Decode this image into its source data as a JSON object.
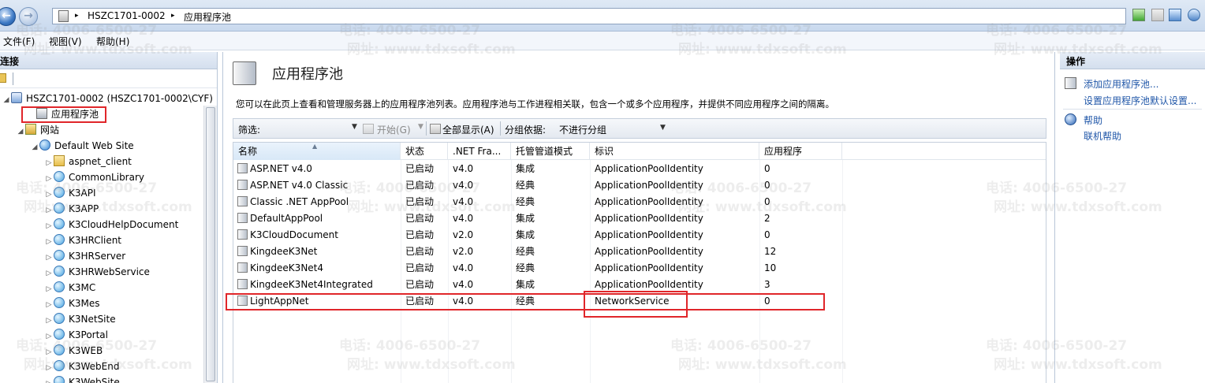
{
  "address_bar": {
    "crumbs": [
      "HSZC1701-0002",
      "应用程序池"
    ],
    "separator": "▸"
  },
  "menu": {
    "items": [
      "文件(F)",
      "视图(V)",
      "帮助(H)"
    ]
  },
  "connections": {
    "title": "连接",
    "tree": [
      {
        "label": "HSZC1701-0002 (HSZC1701-0002\\CYF)",
        "level": 0,
        "expander": "◢",
        "icon": "server-icon"
      },
      {
        "label": "应用程序池",
        "level": 1,
        "expander": "",
        "icon": "app-pools-icon",
        "selected": true
      },
      {
        "label": "网站",
        "level": 1,
        "expander": "◢",
        "icon": "sites-icon"
      },
      {
        "label": "Default Web Site",
        "level": 2,
        "expander": "◢",
        "icon": "globe-icon"
      },
      {
        "label": "aspnet_client",
        "level": 3,
        "expander": "▷",
        "icon": "folder-icon"
      },
      {
        "label": "CommonLibrary",
        "level": 3,
        "expander": "▷",
        "icon": "web-app-icon"
      },
      {
        "label": "K3API",
        "level": 3,
        "expander": "▷",
        "icon": "web-app-icon"
      },
      {
        "label": "K3APP",
        "level": 3,
        "expander": "▷",
        "icon": "web-app-icon"
      },
      {
        "label": "K3CloudHelpDocument",
        "level": 3,
        "expander": "▷",
        "icon": "web-app-icon"
      },
      {
        "label": "K3HRClient",
        "level": 3,
        "expander": "▷",
        "icon": "web-app-icon"
      },
      {
        "label": "K3HRServer",
        "level": 3,
        "expander": "▷",
        "icon": "web-app-icon"
      },
      {
        "label": "K3HRWebService",
        "level": 3,
        "expander": "▷",
        "icon": "web-app-icon"
      },
      {
        "label": "K3MC",
        "level": 3,
        "expander": "▷",
        "icon": "web-app-icon"
      },
      {
        "label": "K3Mes",
        "level": 3,
        "expander": "▷",
        "icon": "web-app-icon"
      },
      {
        "label": "K3NetSite",
        "level": 3,
        "expander": "▷",
        "icon": "web-app-icon"
      },
      {
        "label": "K3Portal",
        "level": 3,
        "expander": "▷",
        "icon": "web-app-icon"
      },
      {
        "label": "K3WEB",
        "level": 3,
        "expander": "▷",
        "icon": "web-app-icon"
      },
      {
        "label": "K3WebEnd",
        "level": 3,
        "expander": "▷",
        "icon": "web-app-icon"
      },
      {
        "label": "K3WebSite",
        "level": 3,
        "expander": "▷",
        "icon": "web-app-icon"
      }
    ]
  },
  "main": {
    "title": "应用程序池",
    "description": "您可以在此页上查看和管理服务器上的应用程序池列表。应用程序池与工作进程相关联，包含一个或多个应用程序，并提供不同应用程序之间的隔离。",
    "filter": {
      "label": "筛选:",
      "start_label": "开始(G)",
      "show_all_label": "全部显示(A)",
      "group_label": "分组依据:",
      "group_value": "不进行分组"
    },
    "columns": [
      "名称",
      "状态",
      ".NET Fra...",
      "托管管道模式",
      "标识",
      "应用程序"
    ],
    "rows": [
      [
        "ASP.NET v4.0",
        "已启动",
        "v4.0",
        "集成",
        "ApplicationPoolIdentity",
        "0"
      ],
      [
        "ASP.NET v4.0 Classic",
        "已启动",
        "v4.0",
        "经典",
        "ApplicationPoolIdentity",
        "0"
      ],
      [
        "Classic .NET AppPool",
        "已启动",
        "v4.0",
        "经典",
        "ApplicationPoolIdentity",
        "0"
      ],
      [
        "DefaultAppPool",
        "已启动",
        "v4.0",
        "集成",
        "ApplicationPoolIdentity",
        "2"
      ],
      [
        "K3CloudDocument",
        "已启动",
        "v2.0",
        "集成",
        "ApplicationPoolIdentity",
        "0"
      ],
      [
        "KingdeeK3Net",
        "已启动",
        "v2.0",
        "经典",
        "ApplicationPoolIdentity",
        "12"
      ],
      [
        "KingdeeK3Net4",
        "已启动",
        "v4.0",
        "经典",
        "ApplicationPoolIdentity",
        "10"
      ],
      [
        "KingdeeK3Net4Integrated",
        "已启动",
        "v4.0",
        "集成",
        "ApplicationPoolIdentity",
        "3"
      ],
      [
        "LightAppNet",
        "已启动",
        "v4.0",
        "经典",
        "NetworkService",
        "0"
      ]
    ]
  },
  "actions": {
    "title": "操作",
    "add_pool": "添加应用程序池...",
    "set_defaults": "设置应用程序池默认设置...",
    "help": "帮助",
    "online_help": "联机帮助"
  },
  "watermark": {
    "phone": "电话: 4006-6500-27",
    "site": "网址: www.tdxsoft.com"
  },
  "colors": {
    "highlight_box": "#e0262a",
    "link": "#1f56a8"
  }
}
